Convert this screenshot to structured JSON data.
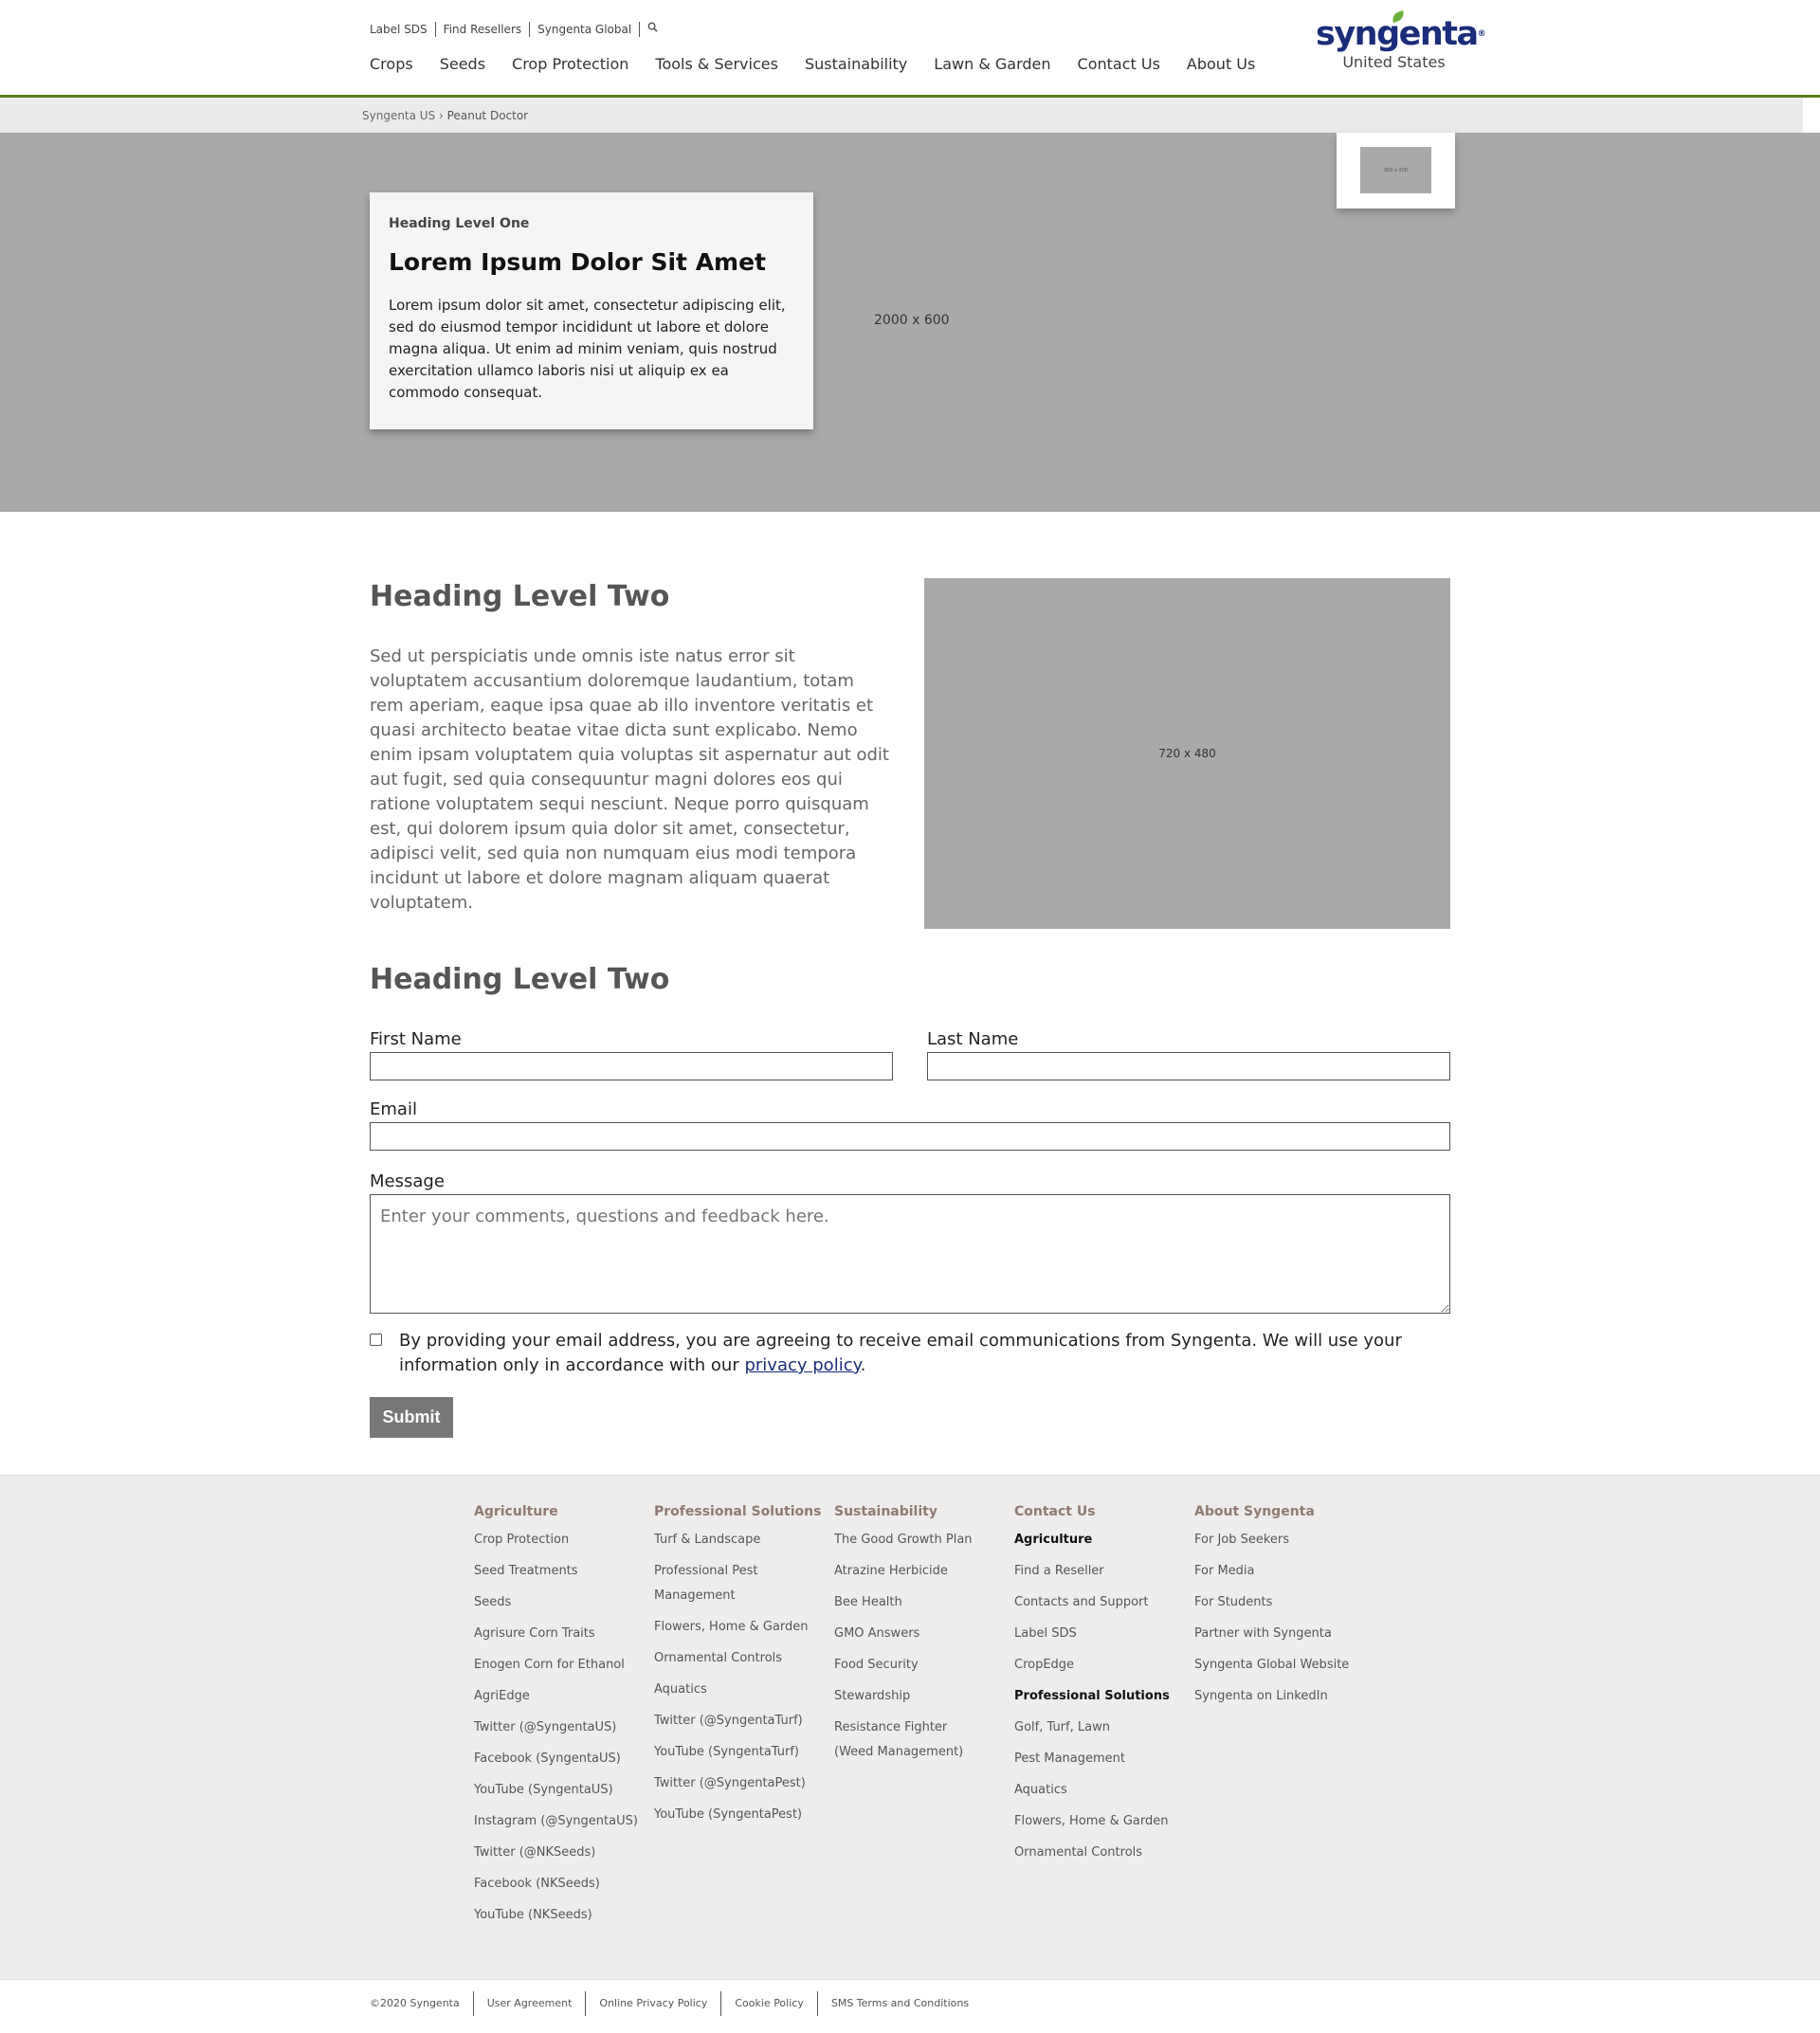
{
  "header": {
    "utility_links": [
      "Label SDS",
      "Find Resellers",
      "Syngenta Global"
    ],
    "search_icon": "search-icon",
    "nav": [
      "Crops",
      "Seeds",
      "Crop Protection",
      "Tools & Services",
      "Sustainability",
      "Lawn & Garden",
      "Contact Us",
      "About Us"
    ],
    "logo_text": "syngenta",
    "logo_reg": "®",
    "logo_sub": "United States",
    "accent_color": "#5a7f1a"
  },
  "breadcrumb": {
    "root": "Syngenta US",
    "separator": "›",
    "current": "Peanut Doctor"
  },
  "hero": {
    "image_size": "2000 x 600",
    "thumb_size": "300 x 200",
    "kicker": "Heading Level One",
    "title": "Lorem Ipsum Dolor Sit Amet",
    "body": "Lorem ipsum dolor sit amet, consectetur adipiscing elit, sed do eiusmod tempor incididunt ut labore et dolore magna aliqua. Ut enim ad minim veniam, quis nostrud exercitation ullamco laboris nisi ut aliquip ex ea commodo consequat."
  },
  "content": {
    "heading": "Heading Level Two",
    "body": "Sed ut perspiciatis unde omnis iste natus error sit voluptatem accusantium doloremque laudantium, totam rem aperiam, eaque ipsa quae ab illo inventore veritatis et quasi architecto beatae vitae dicta sunt explicabo. Nemo enim ipsam voluptatem quia voluptas sit aspernatur aut odit aut fugit, sed quia consequuntur magni dolores eos qui ratione voluptatem sequi nesciunt. Neque porro quisquam est, qui dolorem ipsum quia dolor sit amet, consectetur, adipisci velit, sed quia non numquam eius modi tempora incidunt ut labore et dolore magnam aliquam quaerat voluptatem.",
    "image_size": "720 x 480"
  },
  "form": {
    "heading": "Heading Level Two",
    "first_name_label": "First Name",
    "first_name_value": "",
    "last_name_label": "Last Name",
    "last_name_value": "",
    "email_label": "Email",
    "email_value": "",
    "message_label": "Message",
    "message_placeholder": "Enter your comments, questions and feedback here.",
    "consent_text": "By providing your email address, you are agreeing to receive email communications from Syngenta. We will use your information only in accordance with our ",
    "consent_link": "privacy policy",
    "consent_end": ".",
    "consent_checked": false,
    "submit_label": "Submit"
  },
  "footer": {
    "columns": [
      {
        "title": "Agriculture",
        "items": [
          "Crop Protection",
          "Seed Treatments",
          "Seeds",
          "Agrisure Corn Traits",
          "Enogen Corn for Ethanol",
          "AgriEdge",
          "Twitter (@SyngentaUS)",
          "Facebook (SyngentaUS)",
          "YouTube (SyngentaUS)",
          "Instagram (@SyngentaUS)",
          "Twitter (@NKSeeds)",
          "Facebook (NKSeeds)",
          "YouTube (NKSeeds)"
        ]
      },
      {
        "title": "Professional Solutions",
        "items": [
          "Turf & Landscape",
          "Professional Pest Management",
          "Flowers, Home & Garden",
          "Ornamental Controls",
          "Aquatics",
          "Twitter (@SyngentaTurf)",
          "YouTube (SyngentaTurf)",
          "Twitter (@SyngentaPest)",
          "YouTube (SyngentaPest)"
        ]
      },
      {
        "title": "Sustainability",
        "items": [
          "The Good Growth Plan",
          "Atrazine Herbicide",
          "Bee Health",
          "GMO Answers",
          "Food Security",
          "Stewardship",
          "Resistance Fighter (Weed Management)"
        ]
      },
      {
        "title": "Contact Us",
        "items": [
          "Agriculture",
          "Find a Reseller",
          "Contacts and Support",
          "Label SDS",
          "CropEdge",
          "Professional Solutions",
          "Golf, Turf, Lawn",
          "Pest Management",
          "Aquatics",
          "Flowers, Home & Garden",
          "Ornamental Controls"
        ]
      },
      {
        "title": "About Syngenta",
        "items": [
          "For Job Seekers",
          "For Media",
          "For Students",
          "Partner with Syngenta",
          "Syngenta Global Website",
          "Syngenta on LinkedIn"
        ]
      }
    ],
    "legal": [
      "©2020 Syngenta",
      "User Agreement",
      "Online Privacy Policy",
      "Cookie Policy",
      "SMS Terms and Conditions"
    ]
  }
}
